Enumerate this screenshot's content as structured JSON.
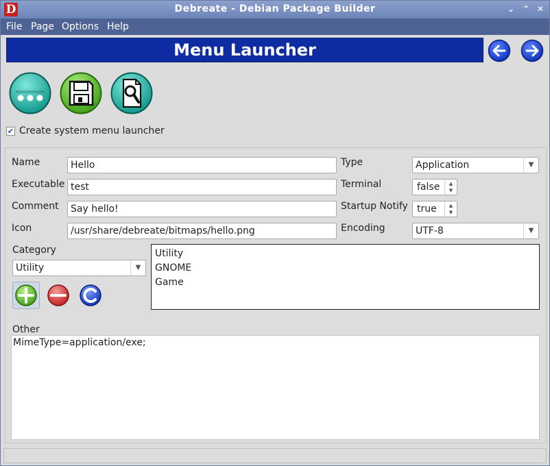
{
  "window": {
    "title": "Debreate - Debian Package Builder",
    "app_icon_letter": "D"
  },
  "menu": {
    "items": [
      "File",
      "Page",
      "Options",
      "Help"
    ]
  },
  "header": {
    "title": "Menu Launcher",
    "back_icon": "arrow-left-icon",
    "forward_icon": "arrow-right-icon"
  },
  "toolbar": {
    "buttons": [
      "more-options-icon",
      "save-icon",
      "preview-icon"
    ]
  },
  "create_launcher": {
    "checked": true,
    "label": "Create system menu launcher"
  },
  "form": {
    "name_label": "Name",
    "name_value": "Hello",
    "executable_label": "Executable",
    "executable_value": "test",
    "comment_label": "Comment",
    "comment_value": "Say hello!",
    "icon_label": "Icon",
    "icon_value": "/usr/share/debreate/bitmaps/hello.png",
    "type_label": "Type",
    "type_value": "Application",
    "terminal_label": "Terminal",
    "terminal_value": "false",
    "startup_notify_label": "Startup Notify",
    "startup_notify_value": "true",
    "encoding_label": "Encoding",
    "encoding_value": "UTF-8"
  },
  "category": {
    "label": "Category",
    "selected": "Utility",
    "list": [
      "Utility",
      "GNOME",
      "Game"
    ]
  },
  "other": {
    "label": "Other",
    "value": "MimeType=application/exe;"
  },
  "colors": {
    "banner": "#0e2da3",
    "teal_button": "#1fb3a3",
    "green_button": "#4cb51e",
    "remove_red": "#d62a2a",
    "clear_blue": "#1a3fbf"
  }
}
